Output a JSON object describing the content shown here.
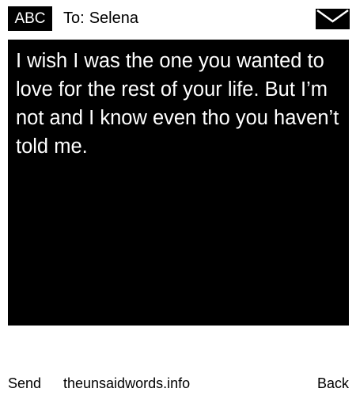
{
  "header": {
    "mode_badge": "ABC",
    "recipient_prefix": "To:",
    "recipient_name": "Selena",
    "icon": "envelope-icon"
  },
  "message": {
    "body": "I wish I was the one you wanted to love for the rest of your life. But I’m not and I know even tho you haven’t told me."
  },
  "footer": {
    "send_label": "Send",
    "site_label": "theunsaidwords.info",
    "back_label": "Back"
  },
  "colors": {
    "background": "#ffffff",
    "message_background": "#000000",
    "message_text": "#ffffff",
    "badge_background": "#000000",
    "badge_text": "#ffffff"
  }
}
